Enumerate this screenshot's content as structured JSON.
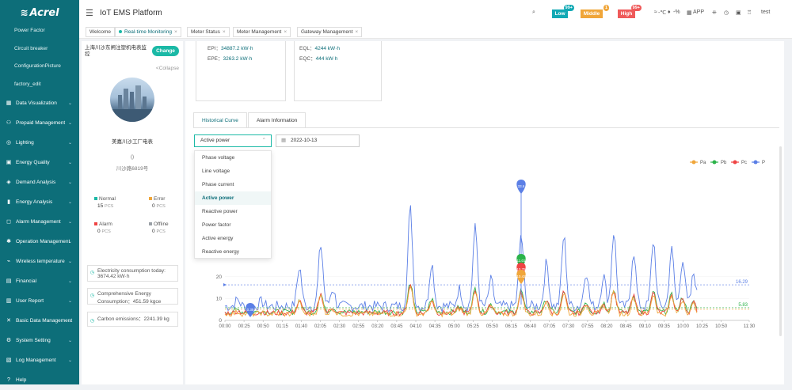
{
  "brand": {
    "logo": "Acrel",
    "mark": "≋"
  },
  "sidebar": {
    "sub_items": [
      "Power Factor",
      "Circuit breaker",
      "ConfigurationPicture",
      "factory_edit"
    ],
    "menu": [
      {
        "label": "Data Visualization",
        "icon": "▦"
      },
      {
        "label": "Prepaid Management",
        "icon": "⚇"
      },
      {
        "label": "Lighting",
        "icon": "◎"
      },
      {
        "label": "Energy Quality",
        "icon": "▣"
      },
      {
        "label": "Demand Analysis",
        "icon": "◈"
      },
      {
        "label": "Energy Analysis",
        "icon": "▮"
      },
      {
        "label": "Alarm Management",
        "icon": "◻"
      },
      {
        "label": "Operation Management",
        "icon": "✱"
      },
      {
        "label": "Wireless temperature",
        "icon": "⌁"
      },
      {
        "label": "Financial",
        "icon": "▤"
      },
      {
        "label": "User Report",
        "icon": "▥"
      },
      {
        "label": "Basic Data Management",
        "icon": "✕"
      },
      {
        "label": "System Setting",
        "icon": "⚙"
      },
      {
        "label": "Log Management",
        "icon": "▧"
      },
      {
        "label": "Help",
        "icon": "?"
      }
    ]
  },
  "header": {
    "title": "IoT EMS Platform",
    "badges": [
      {
        "label": "Low",
        "count": "99+",
        "color": "#12a9b4"
      },
      {
        "label": "Middle",
        "count": "1",
        "color": "#f0a63a"
      },
      {
        "label": "High",
        "count": "99+",
        "color": "#ef5a5a"
      }
    ],
    "weather": "-℃",
    "humidity": "-%",
    "app": "APP",
    "user": "test"
  },
  "tabs": [
    {
      "label": "Welcome"
    },
    {
      "label": "Real-time Monitoring"
    },
    {
      "label": "Meter Status"
    },
    {
      "label": "Meter Management"
    },
    {
      "label": "Gateway Management"
    }
  ],
  "left": {
    "device_title": "上海川沙东闸注塑机电表监控",
    "change_btn": "Change",
    "collapse": "<Collapse",
    "company": "美嘉川沙工厂电表",
    "phone": "()",
    "address": "川沙路6819号",
    "stats": [
      {
        "label": "Normal",
        "value": "15",
        "unit": "PCS",
        "color": "#1bb9a6"
      },
      {
        "label": "Error",
        "value": "0",
        "unit": "PCS",
        "color": "#f0a63a"
      },
      {
        "label": "Alarm",
        "value": "0",
        "unit": "PCS",
        "color": "#ef4444"
      },
      {
        "label": "Offline",
        "value": "0",
        "unit": "PCS",
        "color": "#9aa0a6"
      }
    ],
    "consumption": "Electricity consumption today: 3674.42 kW·h",
    "comprehensive": "Comprehensive Energy Consumption：451.59 kgce",
    "carbon": "Carbon emissions：2241.39 kg"
  },
  "cards": {
    "epi": {
      "label": "EPI：",
      "value": "34887.2 kW·h"
    },
    "epe": {
      "label": "EPE：",
      "value": "3263.2 kW·h"
    },
    "eql": {
      "label": "EQL：",
      "value": "4244 kW·h"
    },
    "eqc": {
      "label": "EQC：",
      "value": "444 kW·h"
    }
  },
  "subtabs": [
    "Historical Curve",
    "Alarm Information"
  ],
  "select_value": "Active power",
  "date_value": "2022-10-13",
  "dropdown_options": [
    "Phase voltage",
    "Line voltage",
    "Phase current",
    "Active power",
    "Reactive power",
    "Power factor",
    "Active energy",
    "Reactive energy"
  ],
  "chart_data": {
    "type": "line",
    "y_ticks": [
      "0",
      "10",
      "20"
    ],
    "x_ticks": [
      "00:00",
      "00:25",
      "00:50",
      "01:15",
      "01:40",
      "02:05",
      "02:30",
      "02:55",
      "03:20",
      "03:45",
      "04:10",
      "04:35",
      "05:00",
      "05:25",
      "05:50",
      "06:15",
      "06:40",
      "07:05",
      "07:30",
      "07:55",
      "08:20",
      "08:45",
      "09:10",
      "09:35",
      "10:00",
      "10:25",
      "10:50",
      "11:30"
    ],
    "series": [
      {
        "name": "Pa",
        "color": "#f0a63a"
      },
      {
        "name": "Pb",
        "color": "#2bb34a"
      },
      {
        "name": "Pc",
        "color": "#ef4444"
      },
      {
        "name": "P",
        "color": "#5b7fe6"
      }
    ],
    "p_average": "16.29",
    "pabc_average": "5.83",
    "markers": [
      {
        "label": "33.6",
        "color": "#5b7fe6"
      },
      {
        "label": "11.01",
        "color": "#2bb34a"
      },
      {
        "label": "10.75",
        "color": "#ef4444"
      },
      {
        "label": "10.42",
        "color": "#f0a63a"
      },
      {
        "label": "0.35",
        "color": "#5b7fe6"
      }
    ]
  }
}
